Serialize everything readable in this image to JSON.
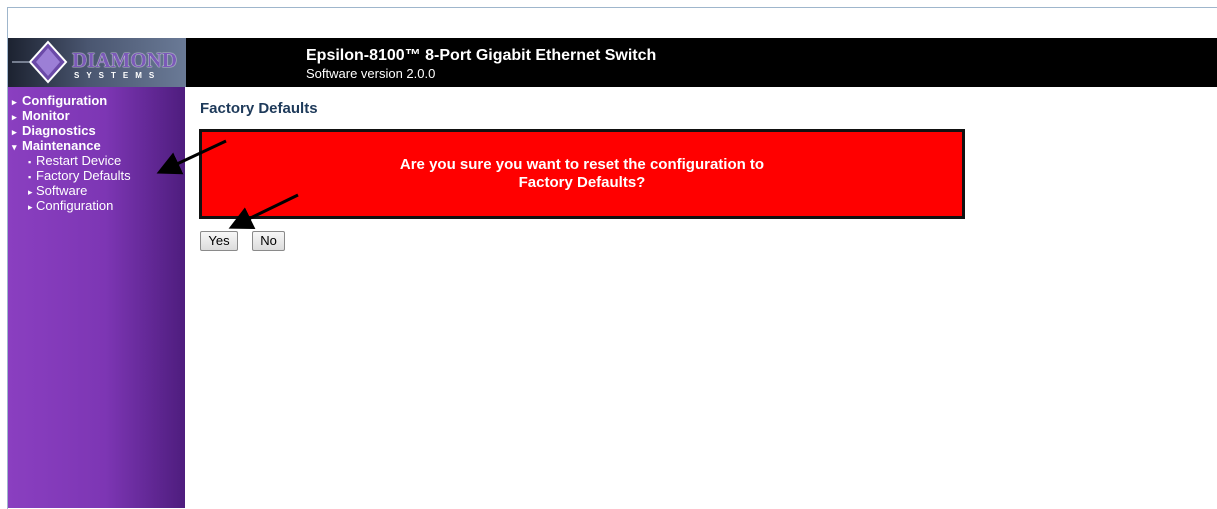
{
  "header": {
    "logo_word": "DIAMOND",
    "logo_sub": "SYSTEMS",
    "title": "Epsilon-8100™ 8-Port Gigabit Ethernet Switch",
    "subtitle": "Software version 2.0.0"
  },
  "sidebar": {
    "items": [
      {
        "label": "Configuration",
        "marker": "▸"
      },
      {
        "label": "Monitor",
        "marker": "▸"
      },
      {
        "label": "Diagnostics",
        "marker": "▸"
      },
      {
        "label": "Maintenance",
        "marker": "▾"
      }
    ],
    "subitems": [
      {
        "label": "Restart Device",
        "marker": "▪"
      },
      {
        "label": "Factory Defaults",
        "marker": "▪"
      },
      {
        "label": "Software",
        "marker": "▸"
      },
      {
        "label": "Configuration",
        "marker": "▸"
      }
    ]
  },
  "main": {
    "page_title": "Factory Defaults",
    "alert_line1": "Are you sure you want to reset the configuration to",
    "alert_line2": "Factory Defaults?",
    "yes_label": "Yes",
    "no_label": "No"
  },
  "colors": {
    "sidebar": "#7d36b4",
    "header": "#000000",
    "alert": "#ff0000",
    "title": "#1e3a5a"
  }
}
